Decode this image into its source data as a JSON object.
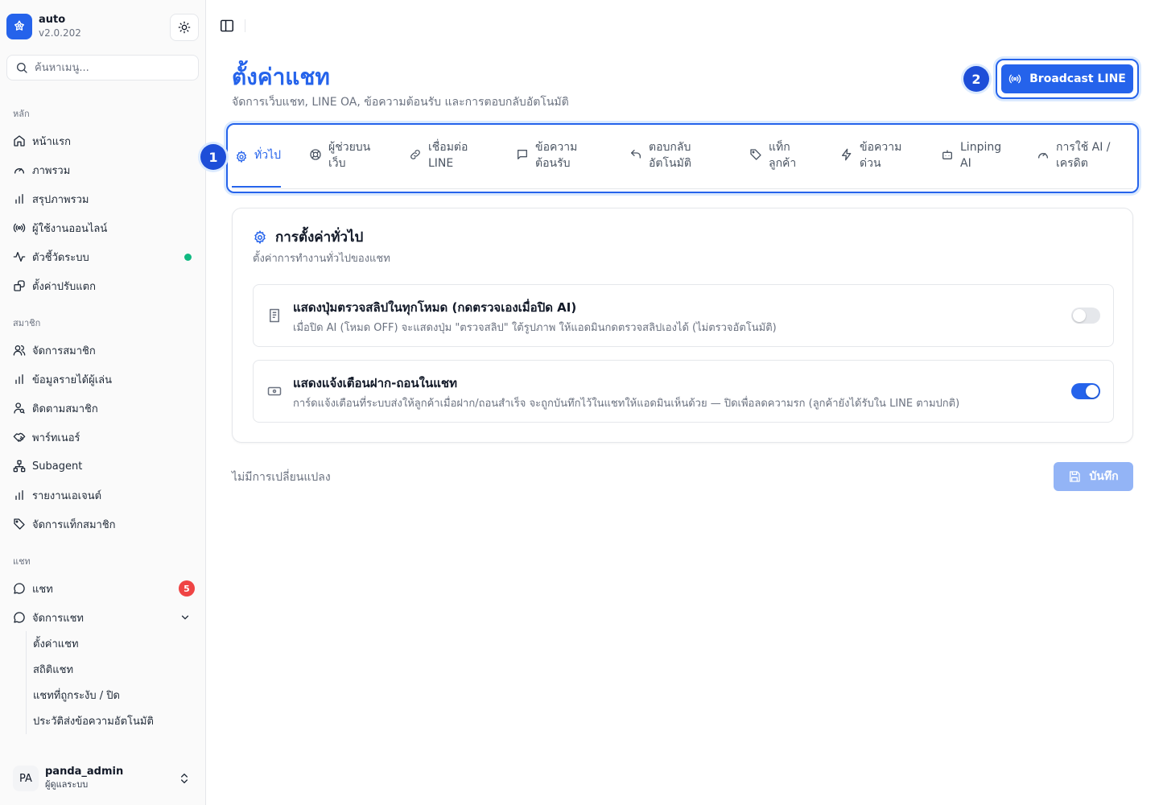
{
  "app": {
    "name": "auto",
    "version": "v2.0.202"
  },
  "search": {
    "placeholder": "ค้นหาเมนู..."
  },
  "sidebar": {
    "sections": [
      "หลัก",
      "สมาชิก",
      "แชท"
    ],
    "main_items": [
      {
        "label": "หน้าแรก",
        "icon": "home-icon"
      },
      {
        "label": "ภาพรวม",
        "icon": "gauge-icon"
      },
      {
        "label": "สรุปภาพรวม",
        "icon": "bar-chart-icon"
      },
      {
        "label": "ผู้ใช้งานออนไลน์",
        "icon": "radio-icon"
      },
      {
        "label": "ตัวชี้วัดระบบ",
        "icon": "activity-icon"
      },
      {
        "label": "ตั้งค่าปรับแตก",
        "icon": "settings-box-icon"
      }
    ],
    "member_items": [
      {
        "label": "จัดการสมาชิก",
        "icon": "users-icon"
      },
      {
        "label": "ข้อมูลรายได้ผู้เล่น",
        "icon": "bar-chart-icon"
      },
      {
        "label": "ติดตามสมาชิก",
        "icon": "user-search-icon"
      },
      {
        "label": "พาร์ทเนอร์",
        "icon": "handshake-icon"
      },
      {
        "label": "Subagent",
        "icon": "network-icon"
      },
      {
        "label": "รายงานเอเจนต์",
        "icon": "bar-chart-icon"
      },
      {
        "label": "จัดการแท็กสมาชิก",
        "icon": "tag-icon"
      }
    ],
    "chat_items": [
      {
        "label": "แชท",
        "icon": "chat-icon",
        "badge": "5"
      },
      {
        "label": "จัดการแชท",
        "icon": "chat-icon"
      }
    ],
    "chat_sub_items": [
      "ตั้งค่าแชท",
      "สถิติแชท",
      "แชทที่ถูกระงับ / ปิด",
      "ประวัติส่งข้อความอัตโนมัติ"
    ],
    "status_dot_color": "#10b981"
  },
  "user": {
    "initials": "PA",
    "name": "panda_admin",
    "role": "ผู้ดูแลระบบ"
  },
  "page": {
    "title": "ตั้งค่าแชท",
    "subtitle": "จัดการเว็บแชท, LINE OA, ข้อความต้อนรับ และการตอบกลับอัตโนมัติ",
    "broadcast_label": "Broadcast LINE"
  },
  "callouts": [
    "1",
    "2"
  ],
  "tabs": [
    {
      "line1": "ทั่วไป",
      "line2": "",
      "icon": "gear-icon",
      "active": true
    },
    {
      "line1": "ผู้ช่วยบน",
      "line2": "เว็บ",
      "icon": "lifebuoy-icon"
    },
    {
      "line1": "เชื่อมต่อ",
      "line2": "LINE",
      "icon": "link-icon"
    },
    {
      "line1": "ข้อความ",
      "line2": "ต้อนรับ",
      "icon": "message-square-icon"
    },
    {
      "line1": "ตอบกลับ",
      "line2": "อัตโนมัติ",
      "icon": "reply-icon"
    },
    {
      "line1": "แท็ก",
      "line2": "ลูกค้า",
      "icon": "tag-icon"
    },
    {
      "line1": "ข้อความ",
      "line2": "ด่วน",
      "icon": "zap-icon"
    },
    {
      "line1": "Linping",
      "line2": "AI",
      "icon": "bot-icon"
    },
    {
      "line1": "การใช้ AI /",
      "line2": "เครดิต",
      "icon": "gauge-icon"
    }
  ],
  "card": {
    "title": "การตั้งค่าทั่วไป",
    "description": "ตั้งค่าการทำงานทั่วไปของแชท",
    "settings": [
      {
        "title": "แสดงปุ่มตรวจสลิปในทุกโหมด (กดตรวจเองเมื่อปิด AI)",
        "description": "เมื่อปิด AI (โหมด OFF) จะแสดงปุ่ม \"ตรวจสลิป\" ใต้รูปภาพ ให้แอดมินกดตรวจสลิปเองได้ (ไม่ตรวจอัตโนมัติ)",
        "icon": "receipt-icon",
        "enabled": false
      },
      {
        "title": "แสดงแจ้งเตือนฝาก-ถอนในแชท",
        "description": "การ์ดแจ้งเตือนที่ระบบส่งให้ลูกค้าเมื่อฝาก/ถอนสำเร็จ จะถูกบันทึกไว้ในแชทให้แอดมินเห็นด้วย — ปิดเพื่อลดความรก (ลูกค้ายังได้รับใน LINE ตามปกติ)",
        "icon": "banknote-icon",
        "enabled": true
      }
    ]
  },
  "footer": {
    "status": "ไม่มีการเปลี่ยนแปลง",
    "save_label": "บันทึก"
  },
  "colors": {
    "accent": "#2563eb",
    "save_disabled": "#93b4f6",
    "badge": "#ef4444"
  }
}
